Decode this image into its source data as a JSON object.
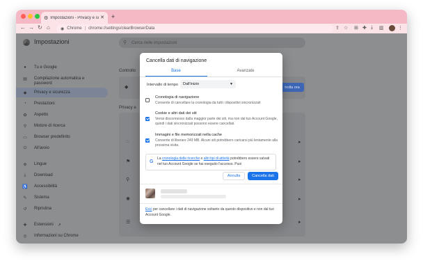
{
  "browser": {
    "tab_title": "Impostazioni - Privacy e sicure",
    "new_tab": "+",
    "omnibox_site": "Chrome",
    "omnibox_url": "chrome://settings/clearBrowserData"
  },
  "settings": {
    "title": "Impostazioni",
    "search_placeholder": "Cerca nelle impostazioni",
    "sidebar": [
      {
        "icon": "person-icon",
        "label": "Tu e Google"
      },
      {
        "icon": "autofill-icon",
        "label": "Compilazione automatica e password"
      },
      {
        "icon": "shield-icon",
        "label": "Privacy e sicurezza"
      },
      {
        "icon": "speed-icon",
        "label": "Prestazioni"
      },
      {
        "icon": "palette-icon",
        "label": "Aspetto"
      },
      {
        "icon": "search-icon",
        "label": "Motore di ricerca"
      },
      {
        "icon": "browser-icon",
        "label": "Browser predefinito"
      },
      {
        "icon": "power-icon",
        "label": "All'avvio"
      },
      {
        "icon": "globe-icon",
        "label": "Lingue"
      },
      {
        "icon": "download-icon",
        "label": "Download"
      },
      {
        "icon": "accessibility-icon",
        "label": "Accessibilità"
      },
      {
        "icon": "wrench-icon",
        "label": "Sistema"
      },
      {
        "icon": "reset-icon",
        "label": "Ripristina"
      },
      {
        "icon": "puzzle-icon",
        "label": "Estensioni"
      },
      {
        "icon": "chrome-icon",
        "label": "Informazioni su Chrome"
      }
    ],
    "section_controllo": "Controllo",
    "section_privacy": "Privacy e",
    "background_button": "trolla ora"
  },
  "dialog": {
    "title": "Cancella dati di navigazione",
    "tabs": [
      "Base",
      "Avanzate"
    ],
    "range_label": "Intervallo di tempo",
    "range_value": "Dall'inizio",
    "options": [
      {
        "title": "Cronologia di navigazione",
        "desc": "Consente di cancellare la cronologia da tutti i dispositivi sincronizzati",
        "checked": false
      },
      {
        "title": "Cookie e altri dati dei siti",
        "desc": "Verrai disconnesso dalla maggior parte dei siti, ma non dal tuo Account Google, quindi i dati sincronizzati possono essere cancellati.",
        "checked": true
      },
      {
        "title": "Immagini e file memorizzati nella cache",
        "desc": "Consente di liberare 249 MB. Alcuni siti potrebbero caricarsi più lentamente alla prossima visita.",
        "checked": true
      }
    ],
    "info_prefix": "La",
    "info_link1": "cronologia delle ricerche",
    "info_mid": "e",
    "info_link2": "altri tipi di attività",
    "info_suffix": "potrebbero essere salvati nel tuo Account Google se hai eseguito l'accesso. Puoi",
    "cancel_label": "Annulla",
    "confirm_label": "Cancella dati",
    "footer_link": "Esci",
    "footer_text": "per cancellare i dati di navigazione soltanto da questo dispositivo e non dal tuo Account Google."
  },
  "colors": {
    "accent": "#1a73e8",
    "tab_strip": "#f5b8c5"
  }
}
